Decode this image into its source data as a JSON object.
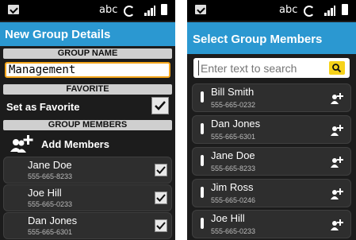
{
  "status_bar": {
    "carrier_text": "abc"
  },
  "left_screen": {
    "title": "New Group Details",
    "group_name_header": "GROUP NAME",
    "group_name_value": "Management",
    "favorite_header": "FAVORITE",
    "favorite_label": "Set as Favorite",
    "favorite_checked": true,
    "members_header": "GROUP MEMBERS",
    "add_members_label": "Add Members",
    "members": [
      {
        "name": "Jane Doe",
        "phone": "555-665-8233",
        "checked": true
      },
      {
        "name": "Joe Hill",
        "phone": "555-665-0233",
        "checked": true
      },
      {
        "name": "Dan Jones",
        "phone": "555-665-6301",
        "checked": true
      }
    ]
  },
  "right_screen": {
    "title": "Select Group Members",
    "search_placeholder": "Enter text to search",
    "contacts": [
      {
        "name": "Bill Smith",
        "phone": "555-665-0232"
      },
      {
        "name": "Dan Jones",
        "phone": "555-665-6301"
      },
      {
        "name": "Jane Doe",
        "phone": "555-665-8233"
      },
      {
        "name": "Jim Ross",
        "phone": "555-665-0246"
      },
      {
        "name": "Joe Hill",
        "phone": "555-665-0233"
      }
    ]
  },
  "colors": {
    "accent": "#2b98d1",
    "highlight": "#f3a51c",
    "search_button": "#f6d21a"
  }
}
